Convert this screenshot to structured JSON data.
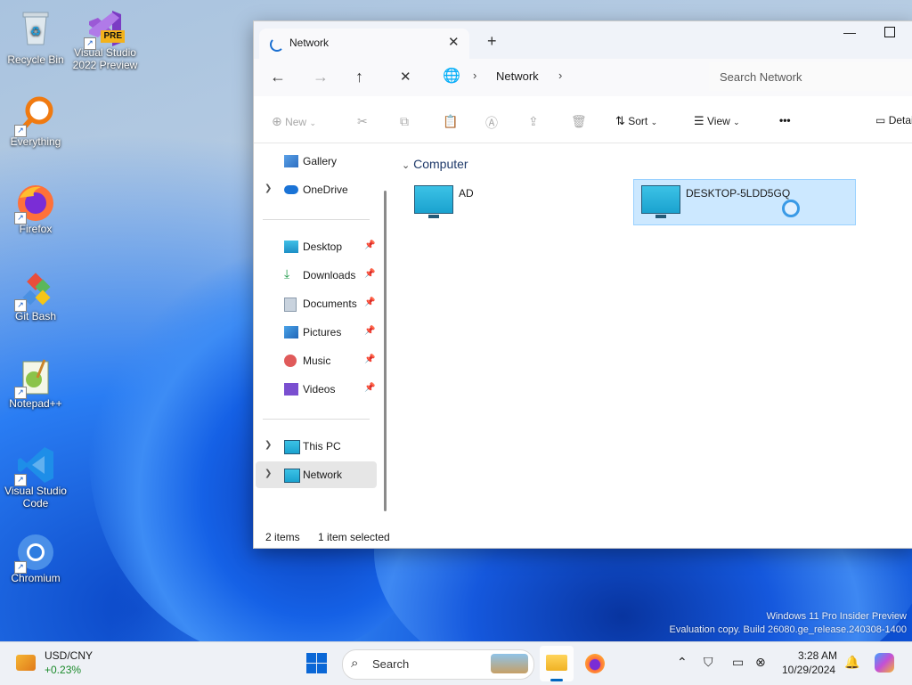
{
  "desktop": {
    "icons": [
      {
        "label_1": "Recycle Bin",
        "label_2": "",
        "icon": "recycle-bin-icon"
      },
      {
        "label_1": "Visual Studio",
        "label_2": "2022 Preview",
        "icon": "visual-studio-preview-icon",
        "badge": "PRE"
      },
      {
        "label_1": "Everything",
        "label_2": "",
        "icon": "everything-search-icon"
      },
      {
        "label_1": "Firefox",
        "label_2": "",
        "icon": "firefox-icon"
      },
      {
        "label_1": "Git Bash",
        "label_2": "",
        "icon": "git-bash-icon"
      },
      {
        "label_1": "Notepad++",
        "label_2": "",
        "icon": "notepad-plus-plus-icon"
      },
      {
        "label_1": "Visual Studio",
        "label_2": "Code",
        "icon": "vscode-icon"
      },
      {
        "label_1": "Chromium",
        "label_2": "",
        "icon": "chromium-icon"
      }
    ],
    "watermark_line1": "Windows 11 Pro Insider Preview",
    "watermark_line2": "Evaluation copy. Build 26080.ge_release.240308-1400"
  },
  "explorer": {
    "tab_title": "Network",
    "address": {
      "crumb": "Network",
      "search_placeholder": "Search Network"
    },
    "toolbar": {
      "new": "New",
      "sort": "Sort",
      "view": "View",
      "more": "•••",
      "details": "Details"
    },
    "sidebar": {
      "items": [
        {
          "label": "Gallery"
        },
        {
          "label": "OneDrive"
        },
        {
          "label": "Desktop"
        },
        {
          "label": "Downloads"
        },
        {
          "label": "Documents"
        },
        {
          "label": "Pictures"
        },
        {
          "label": "Music"
        },
        {
          "label": "Videos"
        },
        {
          "label": "This PC"
        },
        {
          "label": "Network"
        }
      ]
    },
    "content": {
      "group": "Computer",
      "items": [
        {
          "name": "AD",
          "selected": false
        },
        {
          "name": "DESKTOP-5LDD5GQ",
          "selected": true
        }
      ]
    },
    "status": {
      "count": "2 items",
      "selection": "1 item selected"
    }
  },
  "taskbar": {
    "widget_title": "USD/CNY",
    "widget_value": "+0.23%",
    "search_placeholder": "Search",
    "time": "3:28 AM",
    "date": "10/29/2024",
    "accent": "#0067c0"
  }
}
